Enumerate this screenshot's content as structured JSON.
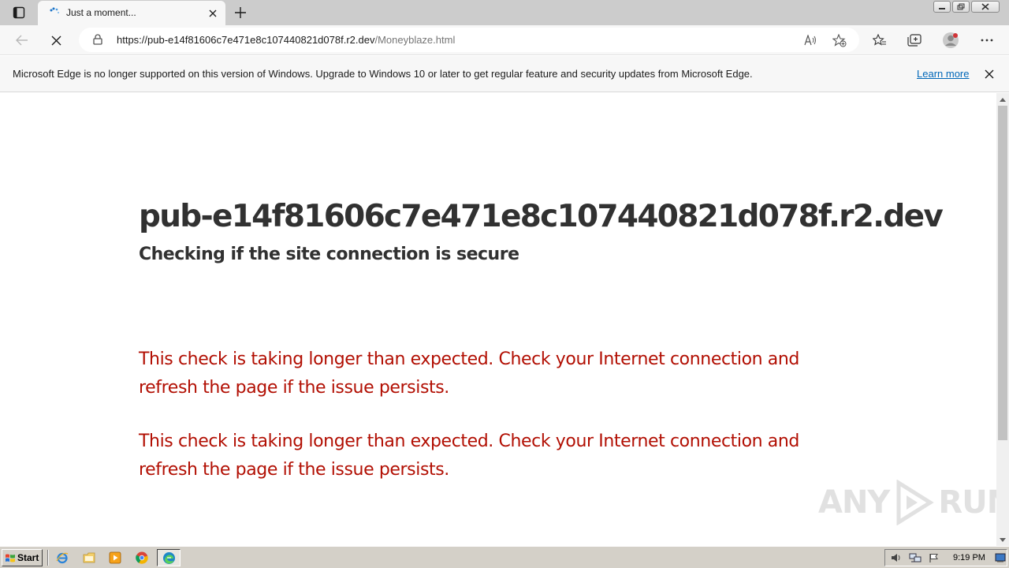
{
  "browser": {
    "tab": {
      "title": "Just a moment..."
    },
    "address": {
      "host_part": "https://pub-e14f81606c7e471e8c107440821d078f.r2.dev",
      "path_part": "/Moneyblaze.html"
    },
    "infobar": {
      "message": "Microsoft Edge is no longer supported on this version of Windows. Upgrade to Windows 10 or later to get regular feature and security updates from Microsoft Edge.",
      "link_label": "Learn more"
    }
  },
  "page": {
    "domain_heading": "pub-e14f81606c7e471e8c107440821d078f.r2.dev",
    "subheading": "Checking if the site connection is secure",
    "errors": [
      "This check is taking longer than expected. Check your Internet connection and refresh the page if the issue persists.",
      "This check is taking longer than expected. Check your Internet connection and refresh the page if the issue persists."
    ],
    "watermark": {
      "left": "ANY",
      "right": "RUN"
    }
  },
  "taskbar": {
    "start_label": "Start",
    "clock": "9:19 PM"
  },
  "colors": {
    "error_text": "#b20f03",
    "heading_text": "#313131",
    "link": "#0067b8",
    "taskbar": "#d4d0c8"
  }
}
